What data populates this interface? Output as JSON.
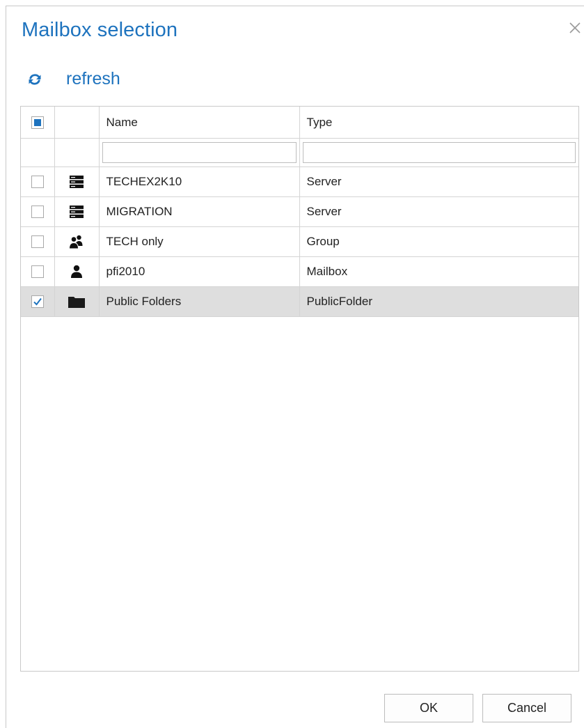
{
  "dialog": {
    "title": "Mailbox selection",
    "close_icon": "close-icon"
  },
  "toolbar": {
    "refresh_label": "refresh",
    "refresh_icon": "refresh-icon"
  },
  "grid": {
    "columns": [
      "Name",
      "Type"
    ],
    "header_checkbox_state": "indeterminate",
    "filters": {
      "name": "",
      "type": ""
    },
    "rows": [
      {
        "name": "TECHEX2K10",
        "type": "Server",
        "icon": "server-icon",
        "checked": false,
        "selected": false
      },
      {
        "name": "MIGRATION",
        "type": "Server",
        "icon": "server-icon",
        "checked": false,
        "selected": false
      },
      {
        "name": "TECH only",
        "type": "Group",
        "icon": "group-icon",
        "checked": false,
        "selected": false
      },
      {
        "name": "pfi2010",
        "type": "Mailbox",
        "icon": "user-icon",
        "checked": false,
        "selected": false
      },
      {
        "name": "Public Folders",
        "type": "PublicFolder",
        "icon": "folder-icon",
        "checked": true,
        "selected": true
      }
    ]
  },
  "buttons": {
    "ok": "OK",
    "cancel": "Cancel"
  },
  "colors": {
    "accent": "#1e73be",
    "selected_row": "#dedede"
  }
}
